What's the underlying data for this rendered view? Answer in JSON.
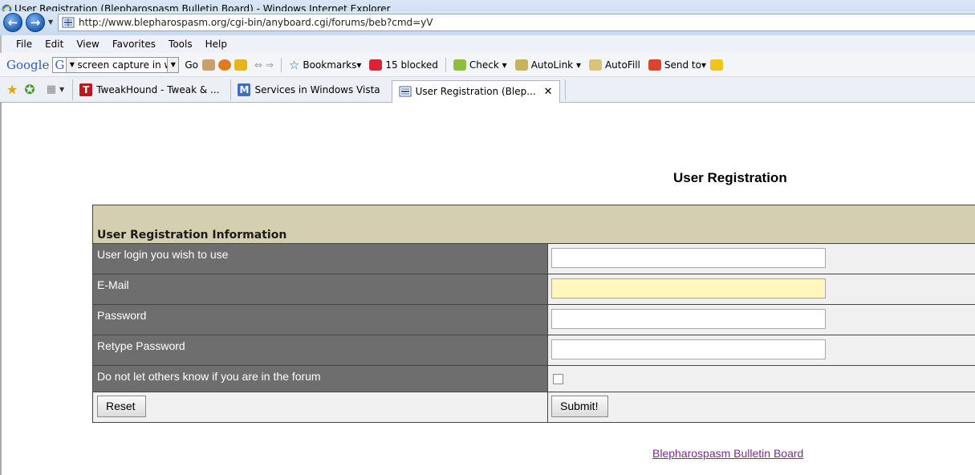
{
  "window": {
    "title": "User Registration (Blepharospasm Bulletin Board) - Windows Internet Explorer"
  },
  "address": {
    "url": "http://www.blepharospasm.org/cgi-bin/anyboard.cgi/forums/beb?cmd=yV"
  },
  "menu": [
    "File",
    "Edit",
    "View",
    "Favorites",
    "Tools",
    "Help"
  ],
  "google_toolbar": {
    "logo": "Google",
    "search_value": "screen capture in windo",
    "go_label": "Go",
    "bookmarks_label": "Bookmarks",
    "blocked_label": "15 blocked",
    "check_label": "Check",
    "autolink_label": "AutoLink",
    "autofill_label": "AutoFill",
    "sendto_label": "Send to"
  },
  "tabs": [
    {
      "label": "TweakHound - Tweak & ...",
      "icon": "T",
      "color": "#c0171b"
    },
    {
      "label": "Services in Windows Vista",
      "icon": "M",
      "color": "#3d6fc1"
    },
    {
      "label": "User Registration (Blep...",
      "icon": "page-icon",
      "color": "#3b5fb0",
      "active": true
    }
  ],
  "page": {
    "heading": "User Registration",
    "section_title": "User Registration Information",
    "fields": {
      "login_label": "User login you wish to use",
      "email_label": "E-Mail",
      "password_label": "Password",
      "retype_label": "Retype Password",
      "hidden_label": "Do not let others know if you are in the forum"
    },
    "reset_label": "Reset",
    "submit_label": "Submit!",
    "footer_link": "Blepharospasm Bulletin Board"
  }
}
